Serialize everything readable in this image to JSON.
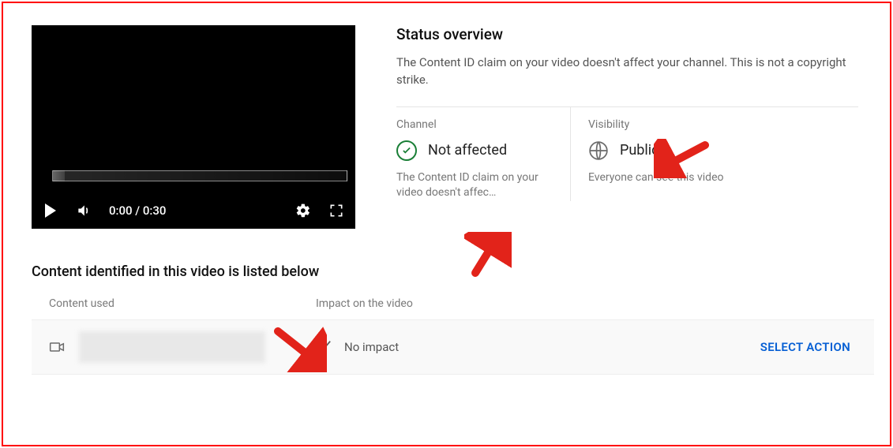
{
  "player": {
    "time_display": "0:00 / 0:30"
  },
  "overview": {
    "title": "Status overview",
    "description": "The Content ID claim on your video doesn't affect your channel. This is not a copyright strike.",
    "channel": {
      "label": "Channel",
      "status": "Not affected",
      "sub": "The Content ID claim on your video doesn't affec…"
    },
    "visibility": {
      "label": "Visibility",
      "status": "Public",
      "sub": "Everyone can see this video"
    }
  },
  "section": {
    "heading": "Content identified in this video is listed below",
    "columns": {
      "content": "Content used",
      "impact": "Impact on the video"
    },
    "row": {
      "impact": "No impact",
      "action": "SELECT ACTION"
    }
  }
}
